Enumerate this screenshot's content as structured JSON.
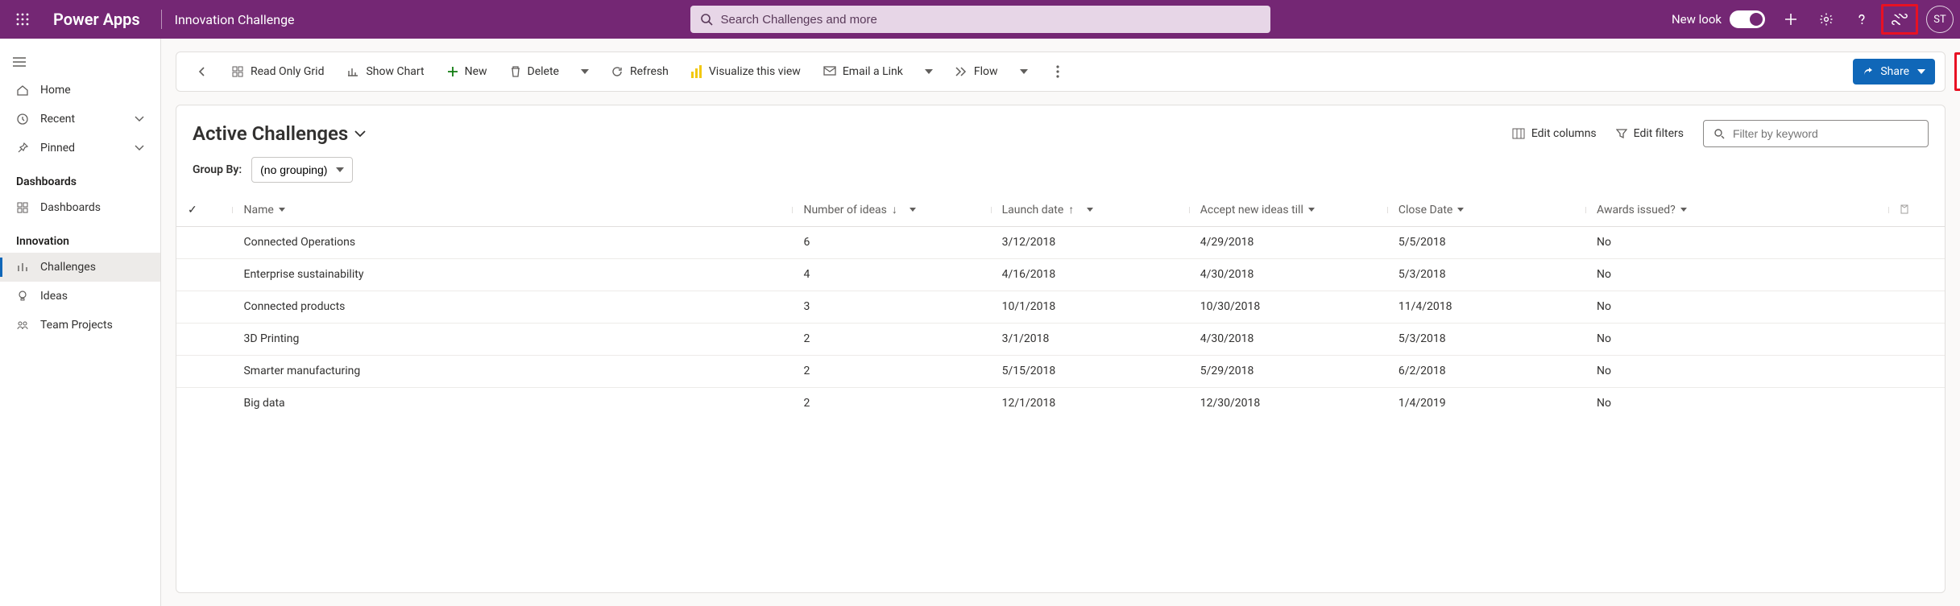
{
  "header": {
    "brand": "Power Apps",
    "app": "Innovation Challenge",
    "search_placeholder": "Search Challenges and more",
    "newlook_label": "New look",
    "avatar_initials": "ST"
  },
  "leftnav": {
    "main": [
      {
        "icon": "home",
        "label": "Home",
        "chev": false
      },
      {
        "icon": "recent",
        "label": "Recent",
        "chev": true
      },
      {
        "icon": "pinned",
        "label": "Pinned",
        "chev": true
      }
    ],
    "groups": [
      {
        "header": "Dashboards",
        "items": [
          {
            "icon": "dash",
            "label": "Dashboards",
            "active": false
          }
        ]
      },
      {
        "header": "Innovation",
        "items": [
          {
            "icon": "challenge",
            "label": "Challenges",
            "active": true
          },
          {
            "icon": "idea",
            "label": "Ideas",
            "active": false
          },
          {
            "icon": "team",
            "label": "Team Projects",
            "active": false
          }
        ]
      }
    ]
  },
  "commandbar": {
    "back": "Back",
    "readonly": "Read Only Grid",
    "showchart": "Show Chart",
    "new": "New",
    "delete": "Delete",
    "refresh": "Refresh",
    "visualize": "Visualize this view",
    "email": "Email a Link",
    "flow": "Flow",
    "share": "Share"
  },
  "view": {
    "name": "Active Challenges",
    "edit_columns": "Edit columns",
    "edit_filters": "Edit filters",
    "filter_placeholder": "Filter by keyword",
    "groupby_label": "Group By:",
    "groupby_value": "(no grouping)"
  },
  "columns": {
    "name": {
      "label": "Name",
      "sort": "none",
      "dir": ""
    },
    "num": {
      "label": "Number of ideas",
      "sort": "desc",
      "dir": "↓"
    },
    "launch": {
      "label": "Launch date",
      "sort": "asc",
      "dir": "↑"
    },
    "accept": {
      "label": "Accept new ideas till",
      "sort": "none",
      "dir": ""
    },
    "close": {
      "label": "Close Date",
      "sort": "none",
      "dir": ""
    },
    "awards": {
      "label": "Awards issued?",
      "sort": "none",
      "dir": ""
    }
  },
  "rows": [
    {
      "name": "Connected Operations",
      "num": 6,
      "launch": "3/12/2018",
      "accept": "4/29/2018",
      "close": "5/5/2018",
      "awards": "No"
    },
    {
      "name": "Enterprise sustainability",
      "num": 4,
      "launch": "4/16/2018",
      "accept": "4/30/2018",
      "close": "5/3/2018",
      "awards": "No"
    },
    {
      "name": "Connected products",
      "num": 3,
      "launch": "10/1/2018",
      "accept": "10/30/2018",
      "close": "11/4/2018",
      "awards": "No"
    },
    {
      "name": "3D Printing",
      "num": 2,
      "launch": "3/1/2018",
      "accept": "4/30/2018",
      "close": "5/3/2018",
      "awards": "No"
    },
    {
      "name": "Smarter manufacturing",
      "num": 2,
      "launch": "5/15/2018",
      "accept": "5/29/2018",
      "close": "6/2/2018",
      "awards": "No"
    },
    {
      "name": "Big data",
      "num": 2,
      "launch": "12/1/2018",
      "accept": "12/30/2018",
      "close": "1/4/2019",
      "awards": "No"
    }
  ]
}
